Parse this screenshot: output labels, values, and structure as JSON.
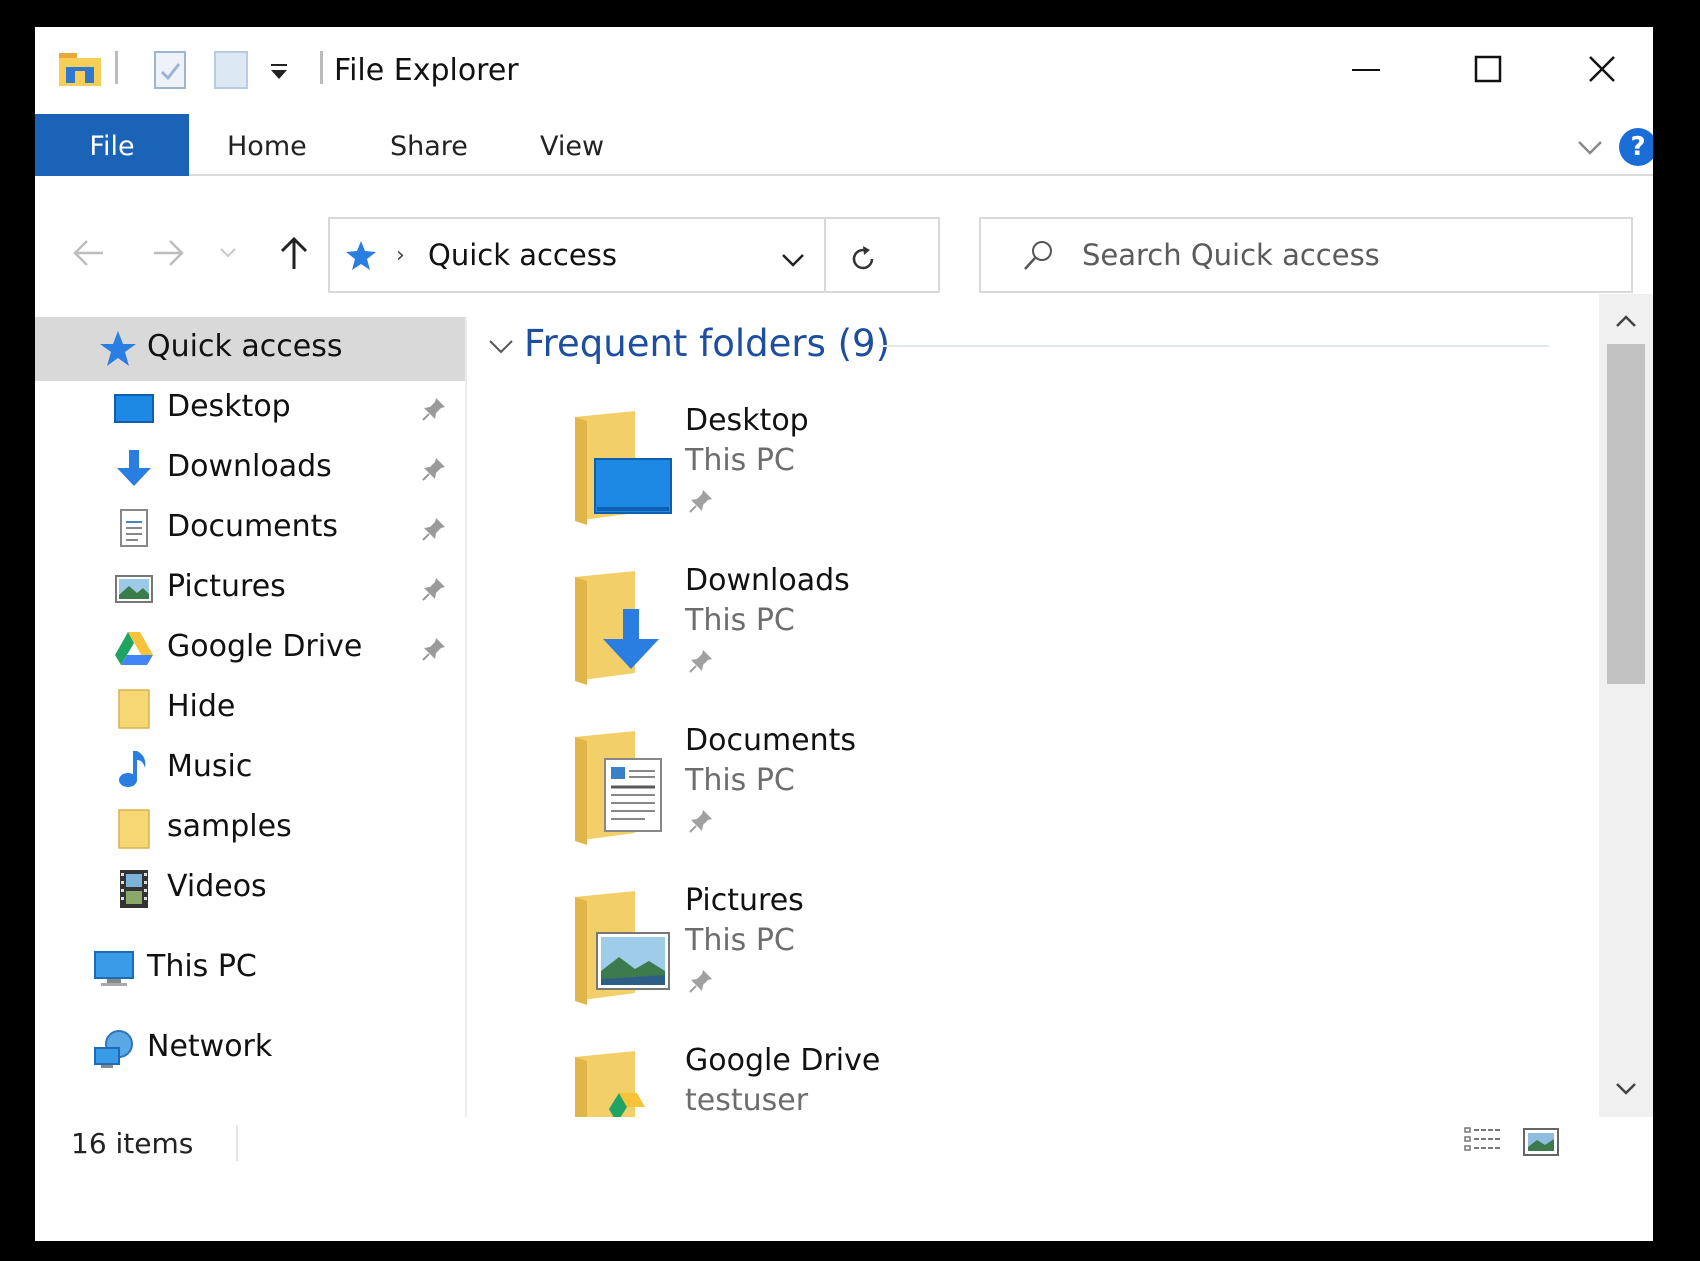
{
  "window": {
    "title": "File Explorer"
  },
  "ribbon": {
    "tabs": [
      {
        "label": "File",
        "active": true
      },
      {
        "label": "Home"
      },
      {
        "label": "Share"
      },
      {
        "label": "View"
      }
    ],
    "help_label": "?"
  },
  "address": {
    "path": "Quick access",
    "search_placeholder": "Search Quick access"
  },
  "navpane": {
    "items": [
      {
        "label": "Quick access",
        "icon": "quick-access-star-icon",
        "selected": true
      },
      {
        "label": "Desktop",
        "icon": "desktop-icon",
        "pinned": true
      },
      {
        "label": "Downloads",
        "icon": "downloads-arrow-icon",
        "pinned": true
      },
      {
        "label": "Documents",
        "icon": "documents-icon",
        "pinned": true
      },
      {
        "label": "Pictures",
        "icon": "pictures-icon",
        "pinned": true
      },
      {
        "label": "Google Drive",
        "icon": "google-drive-icon",
        "pinned": true
      },
      {
        "label": "Hide",
        "icon": "folder-icon"
      },
      {
        "label": "Music",
        "icon": "music-note-icon"
      },
      {
        "label": "samples",
        "icon": "folder-icon"
      },
      {
        "label": "Videos",
        "icon": "videos-film-icon"
      },
      {
        "label": "This PC",
        "icon": "this-pc-icon"
      },
      {
        "label": "Network",
        "icon": "network-icon"
      }
    ]
  },
  "content": {
    "group_title": "Frequent folders (9)",
    "tiles": [
      {
        "name": "Desktop",
        "location": "This PC",
        "pinned": true,
        "icon": "desktop-folder-icon"
      },
      {
        "name": "Downloads",
        "location": "This PC",
        "pinned": true,
        "icon": "downloads-folder-icon"
      },
      {
        "name": "Documents",
        "location": "This PC",
        "pinned": true,
        "icon": "documents-folder-icon"
      },
      {
        "name": "Pictures",
        "location": "This PC",
        "pinned": true,
        "icon": "pictures-folder-icon"
      },
      {
        "name": "Google Drive",
        "location": "testuser",
        "pinned": false,
        "icon": "google-drive-folder-icon"
      }
    ]
  },
  "status": {
    "item_count": "16 items"
  },
  "colors": {
    "accent": "#1a63b6",
    "group_title": "#1e4ea0",
    "selection": "#d9d9d9",
    "folder_yellow": "#f5d46c"
  }
}
